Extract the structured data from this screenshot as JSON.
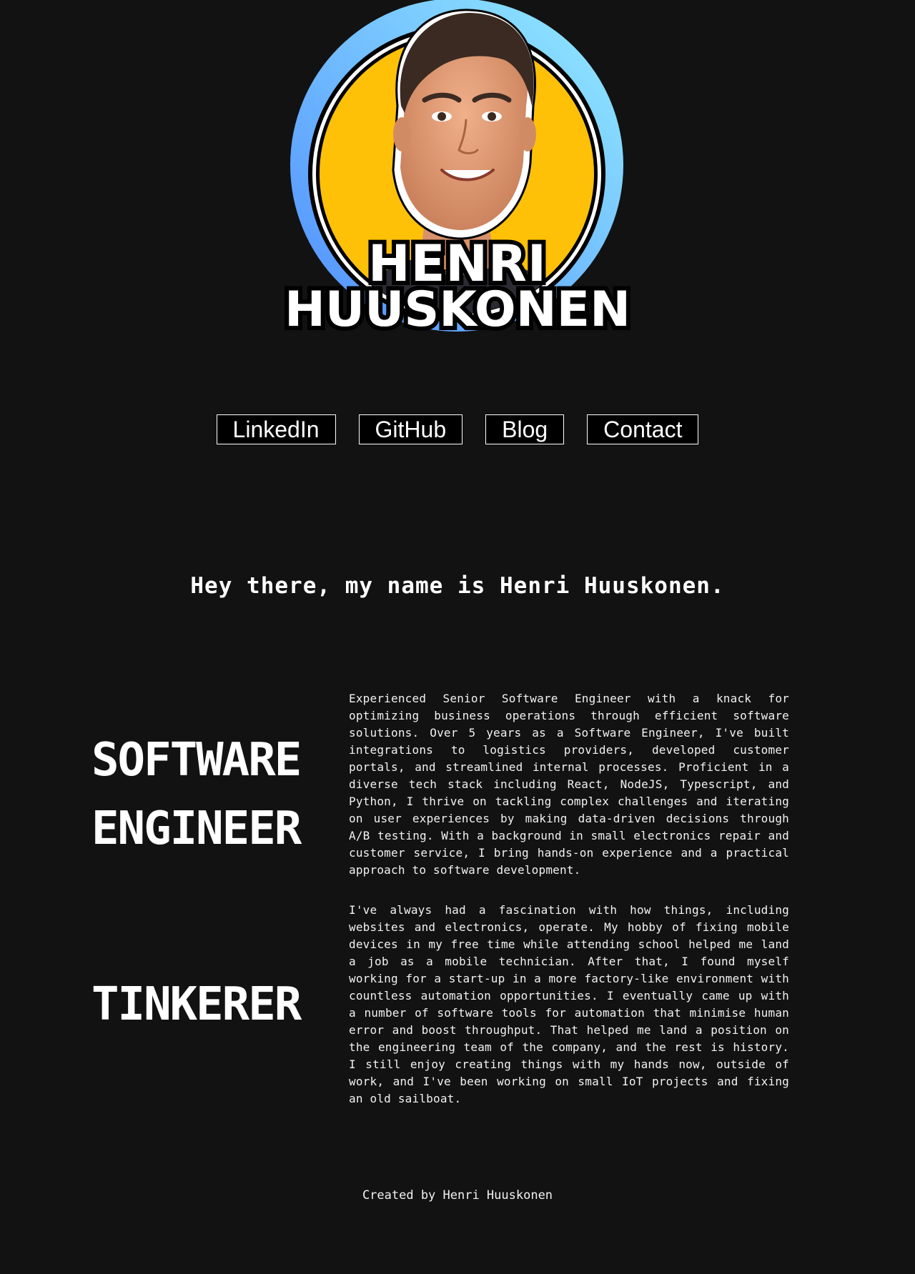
{
  "hero": {
    "name_first": "HENRI",
    "name_last": "HUUSKONEN",
    "avatar_icon": "portrait-avatar",
    "colors": {
      "ring_gradient_start": "#5b9cff",
      "ring_gradient_end": "#8be4ff",
      "avatar_background": "#ffc107",
      "name_fill": "#ffffff",
      "name_outline": "#000000"
    }
  },
  "nav": {
    "items": [
      {
        "label": "LinkedIn"
      },
      {
        "label": "GitHub"
      },
      {
        "label": "Blog"
      },
      {
        "label": "Contact"
      }
    ]
  },
  "intro": {
    "text": "Hey there, my name is Henri Huuskonen."
  },
  "sections": [
    {
      "title": "SOFTWARE ENGINEER",
      "body": "Experienced Senior Software Engineer with a knack for optimizing business operations through efficient software solutions. Over 5 years as a Software Engineer, I've built integrations to logistics providers, developed customer portals, and streamlined internal processes. Proficient in a diverse tech stack including React, NodeJS, Typescript, and Python, I thrive on tackling complex challenges and iterating on user experiences by making data-driven decisions through A/B testing. With a background in small electronics repair and customer service, I bring hands-on experience and a practical approach to software development."
    },
    {
      "title": "TINKERER",
      "body": "I've always had a fascination with how things, including websites and electronics, operate. My hobby of fixing mobile devices in my free time while attending school helped me land a job as a mobile technician. After that, I found myself working for a start-up in a more factory-like environment with countless automation opportunities. I eventually came up with a number of software tools for automation that minimise human error and boost throughput. That helped me land a position on the engineering team of the company, and the rest is history. I still enjoy creating things with my hands now, outside of work, and I've been working on small IoT projects and fixing an old sailboat."
    }
  ],
  "footer": {
    "text": "Created by Henri Huuskonen"
  },
  "theme": {
    "page_background": "#121212",
    "text_color": "#ffffff",
    "button_background": "#000000",
    "button_border": "#ffffff"
  }
}
